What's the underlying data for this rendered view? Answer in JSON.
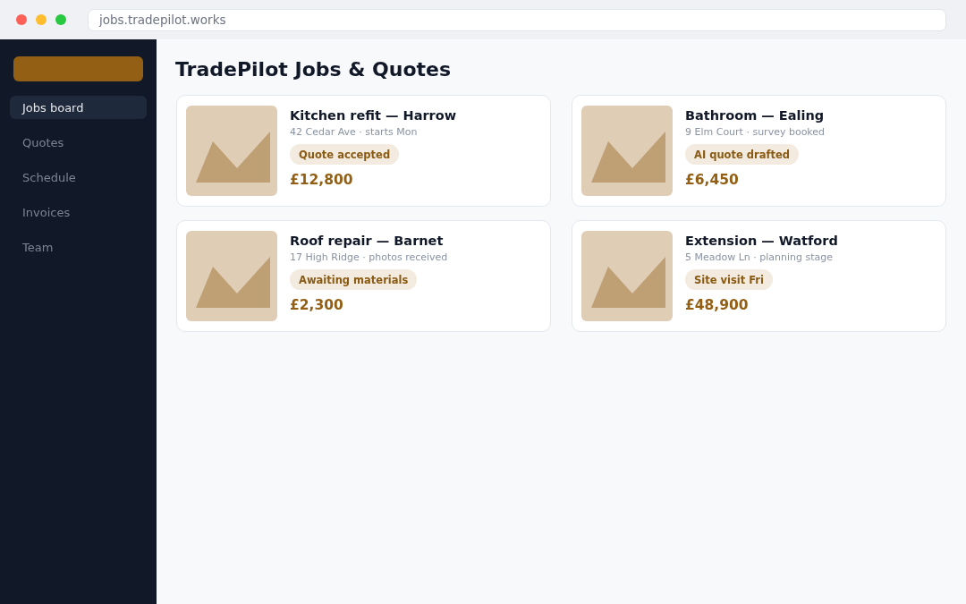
{
  "browser": {
    "url": "jobs.tradepilot.works"
  },
  "sidebar": {
    "items": [
      {
        "label": "Jobs board",
        "selected": true
      },
      {
        "label": "Quotes",
        "selected": false
      },
      {
        "label": "Schedule",
        "selected": false
      },
      {
        "label": "Invoices",
        "selected": false
      },
      {
        "label": "Team",
        "selected": false
      }
    ]
  },
  "page": {
    "title": "TradePilot Jobs & Quotes"
  },
  "jobs": [
    {
      "title": "Kitchen refit — Harrow",
      "details": "42 Cedar Ave · starts Mon",
      "status": "Quote accepted",
      "price": "£12,800"
    },
    {
      "title": "Bathroom — Ealing",
      "details": "9 Elm Court · survey booked",
      "status": "AI quote drafted",
      "price": "£6,450"
    },
    {
      "title": "Roof repair — Barnet",
      "details": "17 High Ridge · photos received",
      "status": "Awaiting materials",
      "price": "£2,300"
    },
    {
      "title": "Extension — Watford",
      "details": "5 Meadow Ln · planning stage",
      "status": "Site visit Fri",
      "price": "£48,900"
    }
  ]
}
